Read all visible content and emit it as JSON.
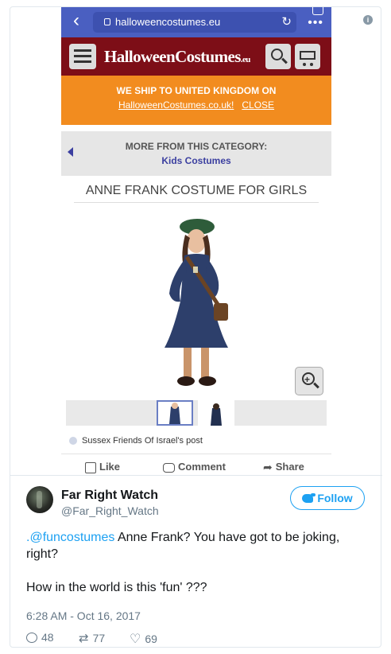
{
  "phone": {
    "url": "halloweencostumes.eu",
    "site_logo": "HalloweenCostumes",
    "site_logo_tld": ".eu",
    "banner_line1": "WE SHIP TO UNITED KINGDOM ON",
    "banner_link": "HalloweenCostumes.co.uk!",
    "banner_close": "CLOSE",
    "category_title": "MORE FROM THIS CATEGORY:",
    "category_link": "Kids Costumes",
    "product_title": "ANNE FRANK COSTUME FOR GIRLS",
    "fb_post_source": "Sussex Friends Of Israel's post",
    "fb_like": "Like",
    "fb_comment": "Comment",
    "fb_share": "Share",
    "colors": {
      "browser_bar": "#4a5fc1",
      "site_header": "#7d0e17",
      "banner": "#f28c1f"
    }
  },
  "tweet": {
    "display_name": "Far Right Watch",
    "handle": "@Far_Right_Watch",
    "follow_label": "Follow",
    "mention": ".@funcostumes",
    "text_line1_rest": " Anne Frank? You have got to be joking, right?",
    "text_line2": "How in the world is this 'fun' ???",
    "timestamp": "6:28 AM - Oct 16, 2017",
    "replies": "48",
    "retweets": "77",
    "likes": "69",
    "colors": {
      "accent": "#1da1f2",
      "muted": "#657786"
    }
  }
}
